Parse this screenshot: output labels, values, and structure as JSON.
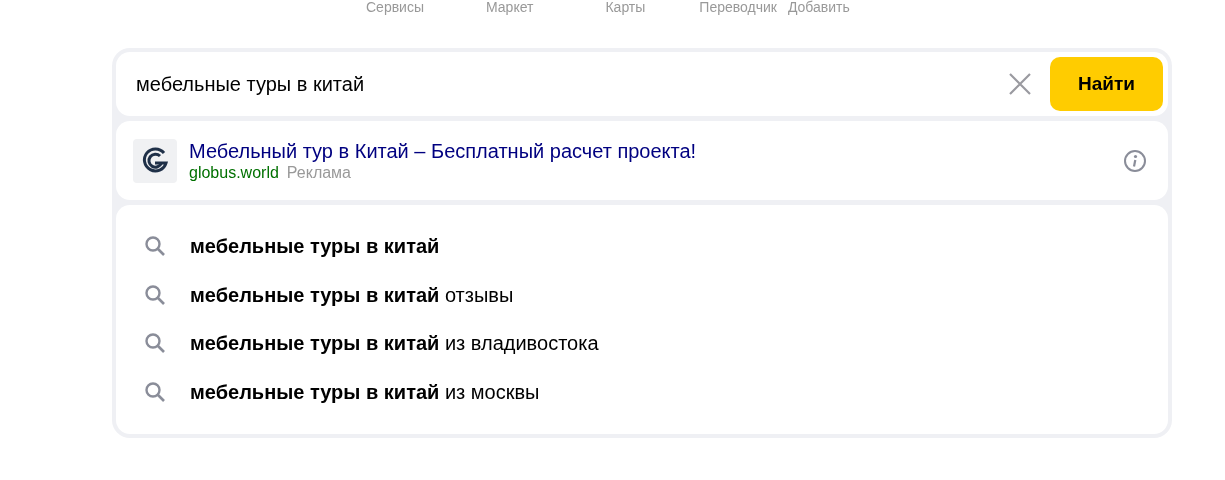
{
  "nav": [
    "Сервисы",
    "Маркет",
    "Карты",
    "Переводчик",
    "Добавить"
  ],
  "search": {
    "value": "мебельные туры в китай",
    "button": "Найти"
  },
  "ad": {
    "title": "Мебельный тур в Китай – Бесплатный расчет проекта!",
    "domain": "globus.world",
    "label": "Реклама"
  },
  "suggestions": [
    {
      "text": "**мебельные туры в китай**"
    },
    {
      "text": "**мебельные туры в китай** отзывы"
    },
    {
      "text": "**мебельные туры в китай** из владивостока"
    },
    {
      "text": "**мебельные туры в китай** из москвы"
    }
  ]
}
